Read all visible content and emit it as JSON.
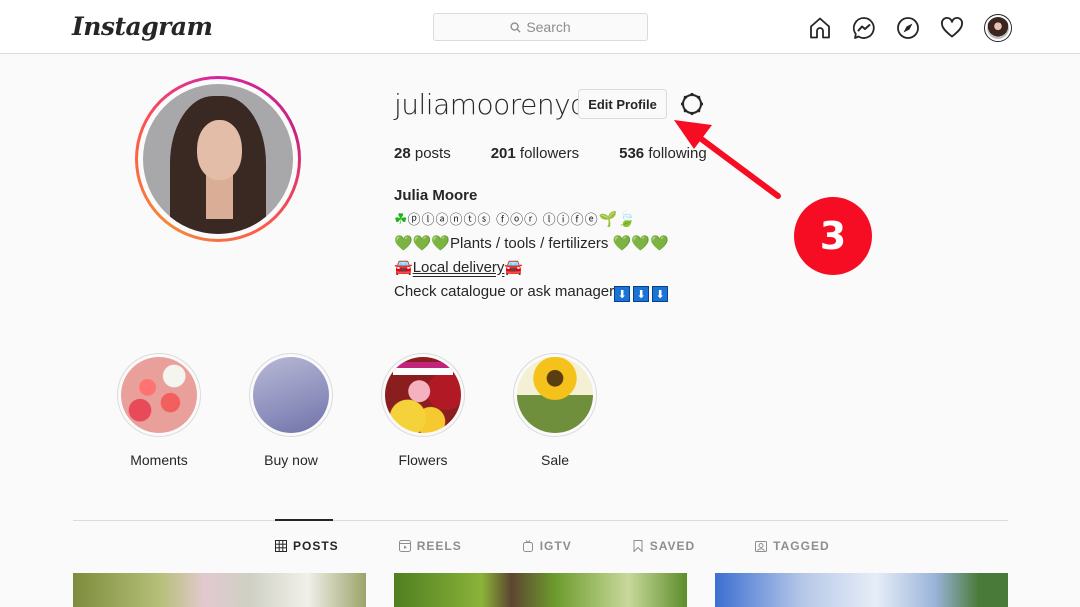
{
  "header": {
    "logo": "Instagram",
    "search_placeholder": "Search",
    "nav_icons": [
      "home-icon",
      "messenger-icon",
      "explore-icon",
      "heart-icon",
      "profile-avatar"
    ]
  },
  "profile": {
    "username": "juliamoorenyc",
    "edit_profile_label": "Edit Profile",
    "stats": {
      "posts_count": "28",
      "posts_label": "posts",
      "followers_count": "201",
      "followers_label": "followers",
      "following_count": "536",
      "following_label": "following"
    },
    "bio": {
      "name": "Julia Moore",
      "line1_prefix": "☘",
      "line1_text": "ⓟⓛⓐⓝⓣⓢ ⓕⓞⓡ ⓛⓘⓕⓔ",
      "line1_suffix": "🌱🍃",
      "line2_hearts_left": "💚💚💚",
      "line2_text": "Plants / tools / fertilizers ",
      "line2_hearts_right": "💚💚💚",
      "line3_icon": "🚘",
      "line3_link": "Local delivery",
      "line4_text": "Check catalogue or ask manager",
      "line4_arrows": [
        "⬇",
        "⬇",
        "⬇"
      ]
    }
  },
  "highlights": [
    {
      "label": "Moments"
    },
    {
      "label": "Buy now"
    },
    {
      "label": "Flowers"
    },
    {
      "label": "Sale"
    }
  ],
  "tabs": [
    {
      "label": "POSTS",
      "icon": "grid-icon",
      "active": true
    },
    {
      "label": "REELS",
      "icon": "reels-icon",
      "active": false
    },
    {
      "label": "IGTV",
      "icon": "igtv-icon",
      "active": false
    },
    {
      "label": "SAVED",
      "icon": "bookmark-icon",
      "active": false
    },
    {
      "label": "TAGGED",
      "icon": "tagged-icon",
      "active": false
    }
  ],
  "annotation": {
    "step_number": "3",
    "color": "#f70d23"
  }
}
